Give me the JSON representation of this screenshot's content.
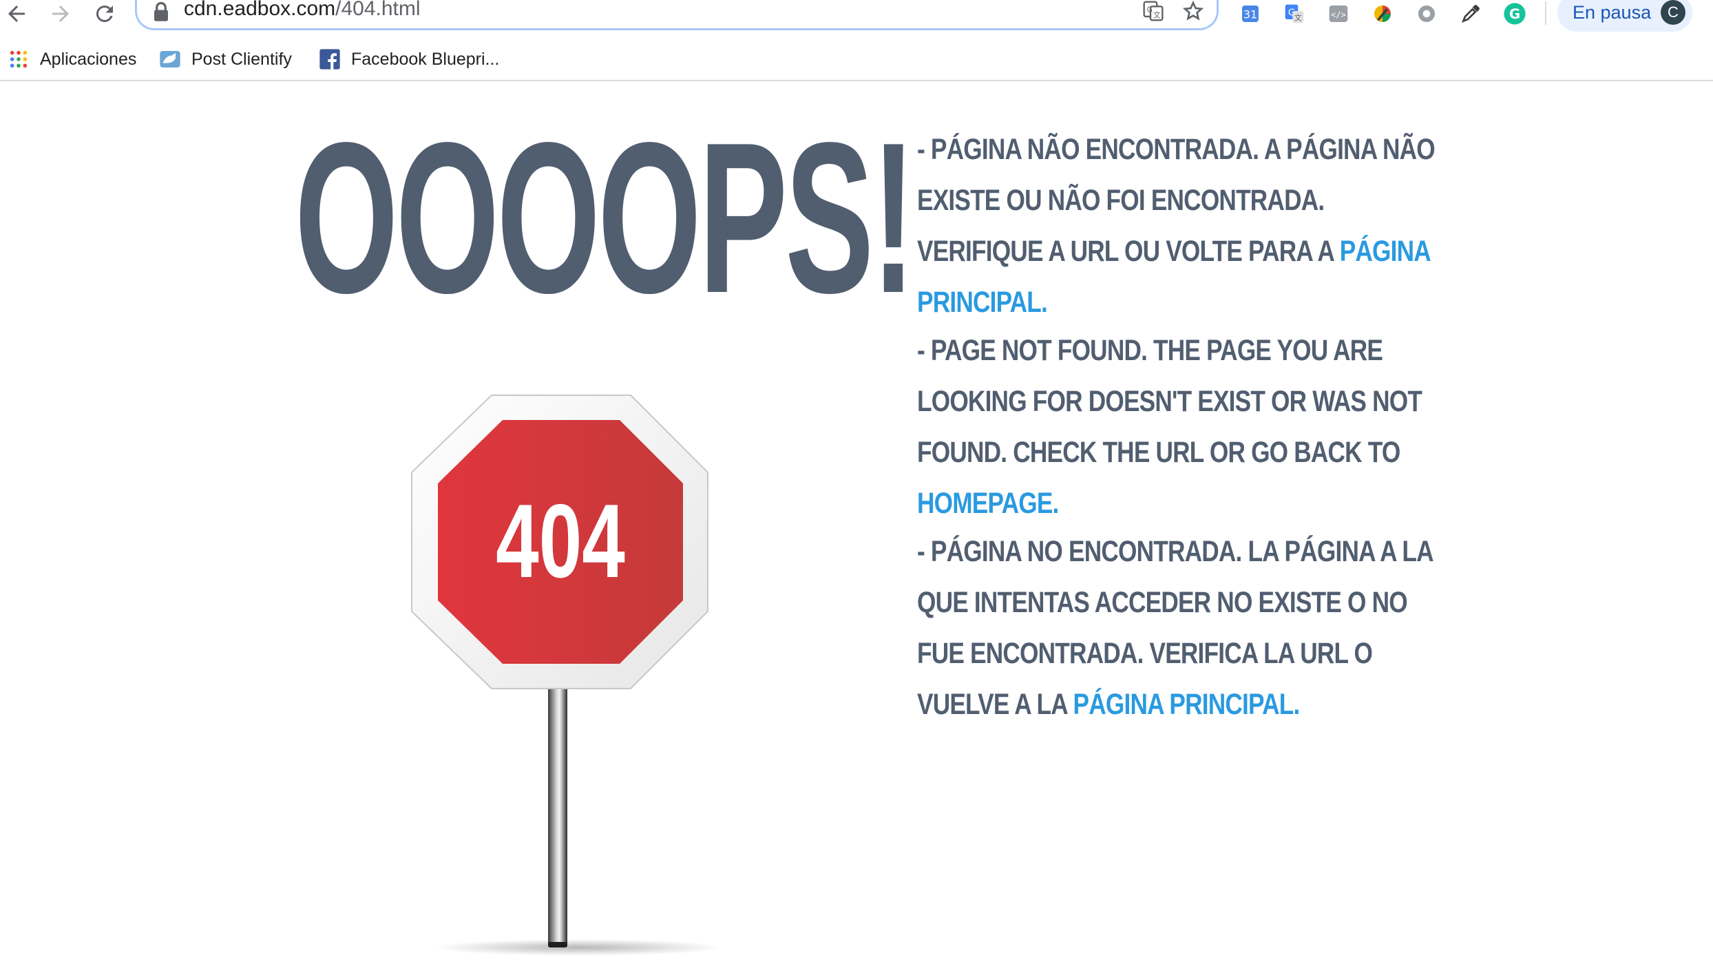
{
  "browser": {
    "url_host": "cdn.eadbox.com",
    "url_path": "/404.html",
    "profile_status": "En pausa",
    "profile_initial": "C",
    "accent_color": "#1a73e8"
  },
  "bookmarks": [
    {
      "label": "Aplicaciones",
      "icon": "apps-grid-icon"
    },
    {
      "label": "Post Clientify",
      "icon": "clientify-icon"
    },
    {
      "label": "Facebook Bluepri...",
      "icon": "facebook-icon"
    }
  ],
  "page": {
    "headline": "OOOOPS!",
    "sign_code": "404",
    "messages": [
      {
        "text": "- Página não encontrada. A página não existe ou não foi encontrada. Verifique a URL ou volte para a ",
        "link": "página principal."
      },
      {
        "text": "- Page not found. The page you are looking for doesn't exist or was not found. Check the URL or go back to ",
        "link": "homepage."
      },
      {
        "text": "- Página no encontrada. La página a la que intentas acceder no existe o no fue encontrada. Verifica la URL o vuelve a la ",
        "link": "página principal."
      }
    ],
    "colors": {
      "text": "#515e70",
      "link": "#2a9ae0",
      "sign_red": "#d43a3e"
    }
  }
}
